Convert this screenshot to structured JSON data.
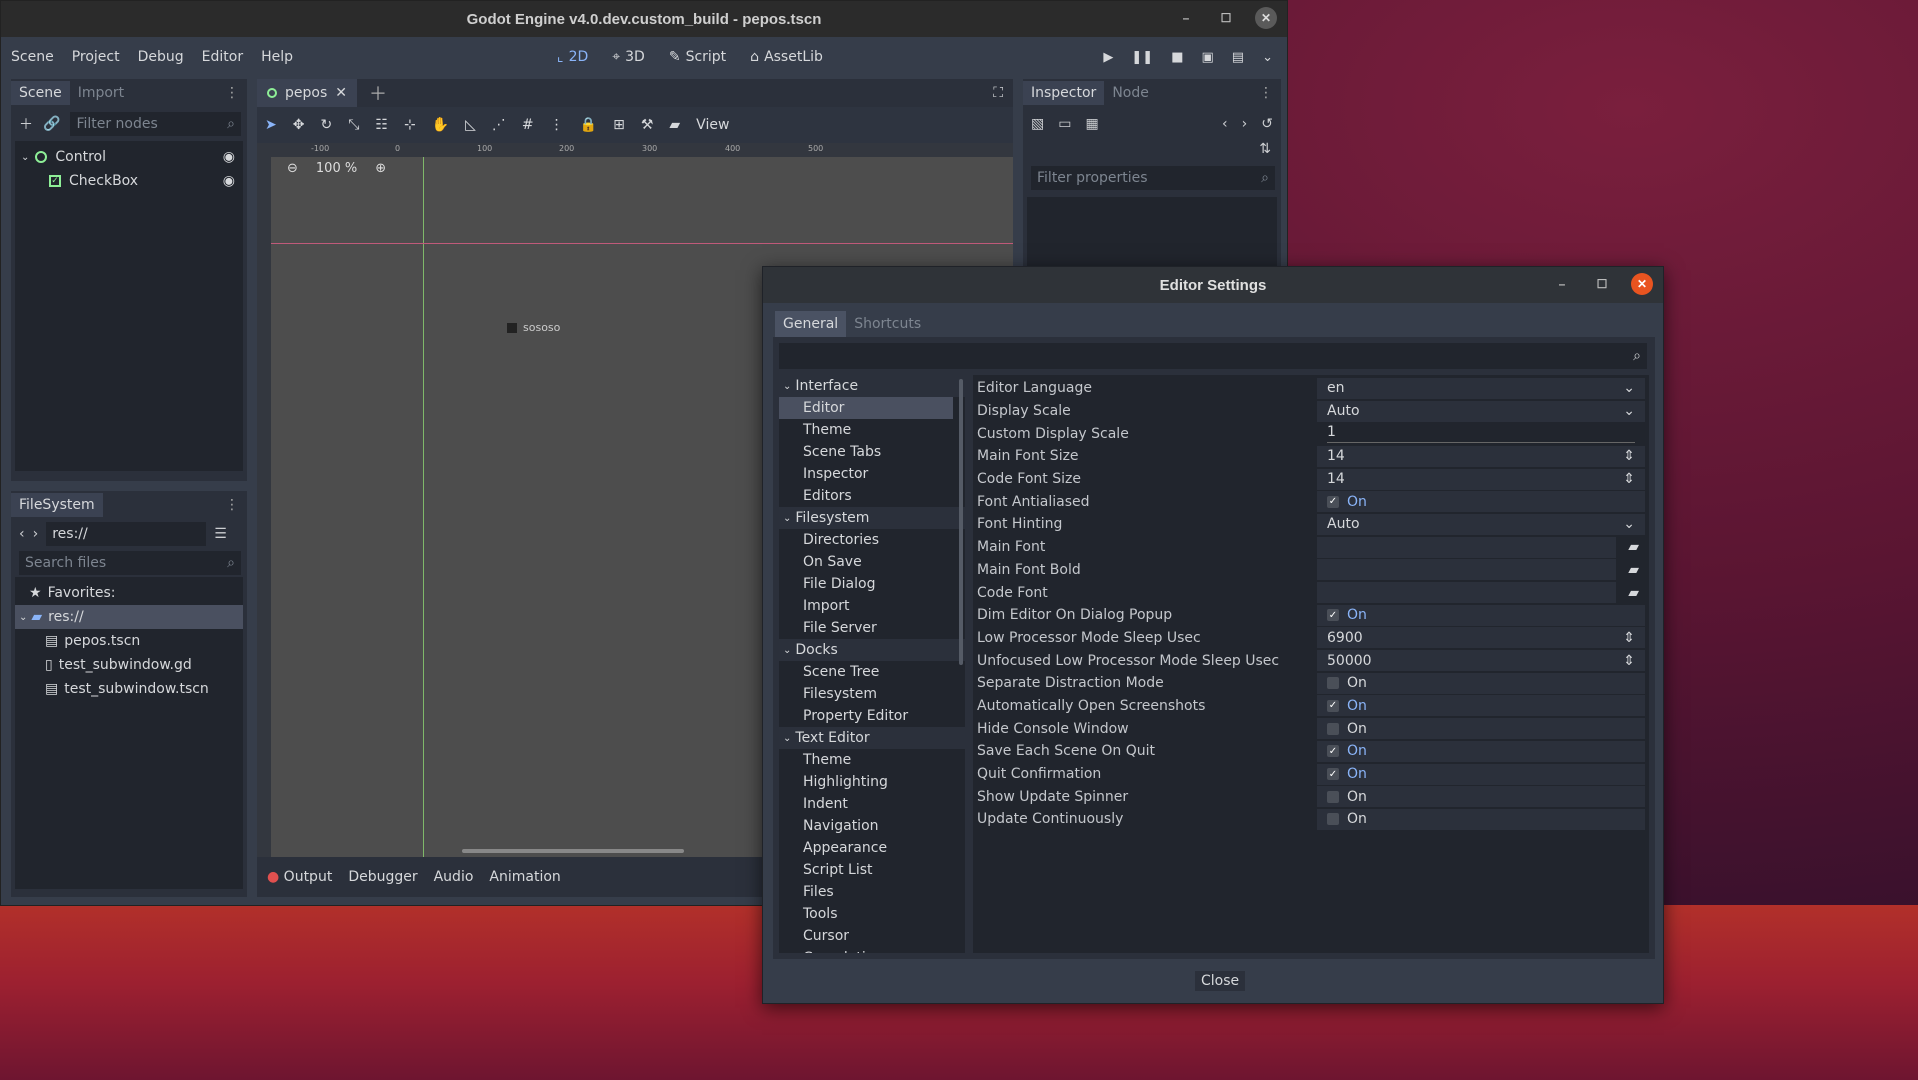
{
  "window_title": "Godot Engine v4.0.dev.custom_build - pepos.tscn",
  "menu": [
    "Scene",
    "Project",
    "Debug",
    "Editor",
    "Help"
  ],
  "workspaces": [
    "2D",
    "3D",
    "Script",
    "AssetLib"
  ],
  "scene_dock": {
    "tabs": [
      "Scene",
      "Import"
    ],
    "filter_placeholder": "Filter nodes",
    "nodes": [
      "Control",
      "CheckBox"
    ]
  },
  "filesystem": {
    "tab": "FileSystem",
    "path": "res://",
    "search_placeholder": "Search files",
    "favorites": "Favorites:",
    "root": "res://",
    "files": [
      "pepos.tscn",
      "test_subwindow.gd",
      "test_subwindow.tscn"
    ]
  },
  "scene_tab": "pepos",
  "view_menu": "View",
  "zoom": "100 %",
  "ruler_marks": [
    "-100",
    "0",
    "100",
    "200",
    "300",
    "400",
    "500"
  ],
  "canvas_checkbox_label": "sososo",
  "bottom_tabs": [
    "Output",
    "Debugger",
    "Audio",
    "Animation"
  ],
  "inspector": {
    "tabs": [
      "Inspector",
      "Node"
    ],
    "filter_placeholder": "Filter properties"
  },
  "settings": {
    "title": "Editor Settings",
    "tabs": [
      "General",
      "Shortcuts"
    ],
    "categories": [
      {
        "name": "Interface",
        "section": true
      },
      {
        "name": "Editor",
        "selected": true
      },
      {
        "name": "Theme"
      },
      {
        "name": "Scene Tabs"
      },
      {
        "name": "Inspector"
      },
      {
        "name": "Editors"
      },
      {
        "name": "Filesystem",
        "section": true
      },
      {
        "name": "Directories"
      },
      {
        "name": "On Save"
      },
      {
        "name": "File Dialog"
      },
      {
        "name": "Import"
      },
      {
        "name": "File Server"
      },
      {
        "name": "Docks",
        "section": true
      },
      {
        "name": "Scene Tree"
      },
      {
        "name": "Filesystem"
      },
      {
        "name": "Property Editor"
      },
      {
        "name": "Text Editor",
        "section": true
      },
      {
        "name": "Theme"
      },
      {
        "name": "Highlighting"
      },
      {
        "name": "Indent"
      },
      {
        "name": "Navigation"
      },
      {
        "name": "Appearance"
      },
      {
        "name": "Script List"
      },
      {
        "name": "Files"
      },
      {
        "name": "Tools"
      },
      {
        "name": "Cursor"
      },
      {
        "name": "Completion"
      }
    ],
    "properties": [
      {
        "label": "Editor Language",
        "type": "dropdown",
        "value": "en"
      },
      {
        "label": "Display Scale",
        "type": "dropdown",
        "value": "Auto"
      },
      {
        "label": "Custom Display Scale",
        "type": "slider",
        "value": "1"
      },
      {
        "label": "Main Font Size",
        "type": "spin",
        "value": "14"
      },
      {
        "label": "Code Font Size",
        "type": "spin",
        "value": "14"
      },
      {
        "label": "Font Antialiased",
        "type": "check",
        "checked": true,
        "value": "On"
      },
      {
        "label": "Font Hinting",
        "type": "dropdown",
        "value": "Auto"
      },
      {
        "label": "Main Font",
        "type": "file",
        "value": ""
      },
      {
        "label": "Main Font Bold",
        "type": "file",
        "value": ""
      },
      {
        "label": "Code Font",
        "type": "file",
        "value": ""
      },
      {
        "label": "Dim Editor On Dialog Popup",
        "type": "check",
        "checked": true,
        "value": "On"
      },
      {
        "label": "Low Processor Mode Sleep Usec",
        "type": "spin",
        "value": "6900"
      },
      {
        "label": "Unfocused Low Processor Mode Sleep Usec",
        "type": "spin",
        "value": "50000"
      },
      {
        "label": "Separate Distraction Mode",
        "type": "check",
        "checked": false,
        "value": "On"
      },
      {
        "label": "Automatically Open Screenshots",
        "type": "check",
        "checked": true,
        "value": "On"
      },
      {
        "label": "Hide Console Window",
        "type": "check",
        "checked": false,
        "value": "On"
      },
      {
        "label": "Save Each Scene On Quit",
        "type": "check",
        "checked": true,
        "value": "On"
      },
      {
        "label": "Quit Confirmation",
        "type": "check",
        "checked": true,
        "value": "On"
      },
      {
        "label": "Show Update Spinner",
        "type": "check",
        "checked": false,
        "value": "On"
      },
      {
        "label": "Update Continuously",
        "type": "check",
        "checked": false,
        "value": "On"
      }
    ],
    "close_label": "Close"
  }
}
